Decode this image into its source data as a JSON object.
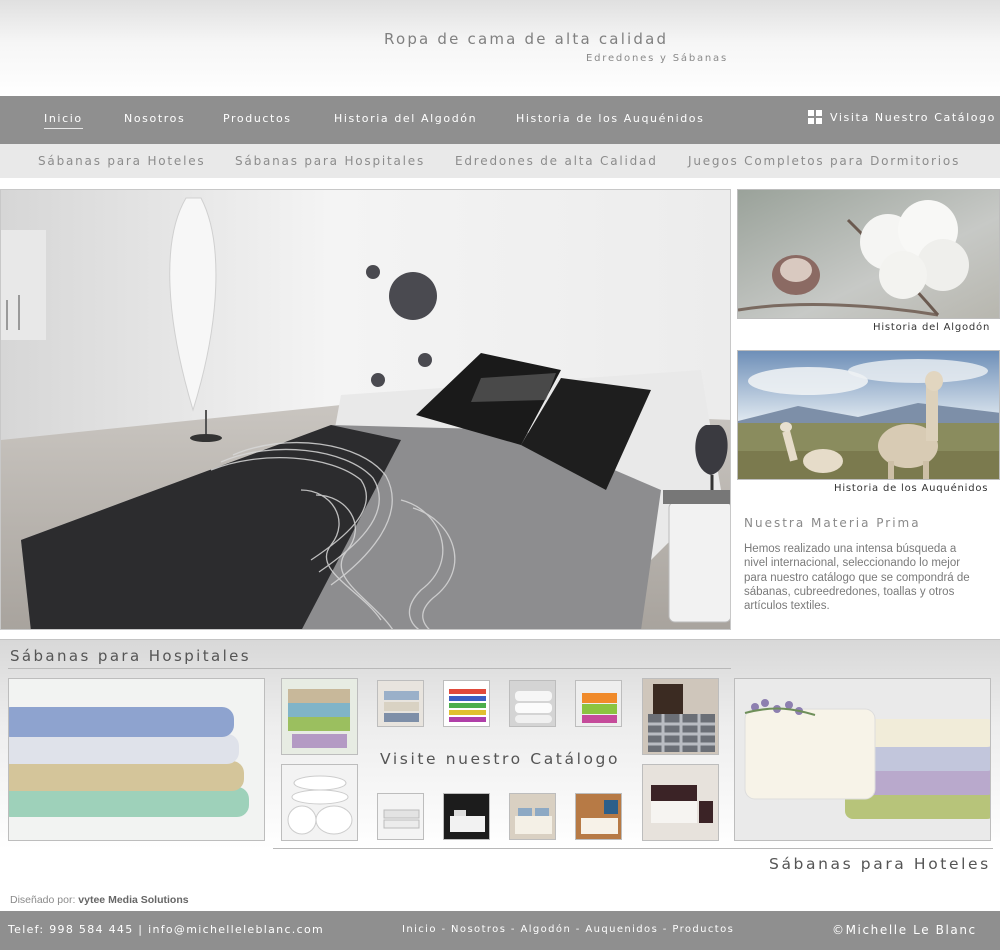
{
  "header": {
    "title": "Ropa de cama de alta calidad",
    "subtitle": "Edredones y Sábanas"
  },
  "main_nav": {
    "items": [
      {
        "label": "Inicio",
        "active": true
      },
      {
        "label": "Nosotros"
      },
      {
        "label": "Productos"
      },
      {
        "label": "Historia del Algodón"
      },
      {
        "label": "Historia de los Auquénidos"
      }
    ],
    "catalog_link": {
      "label": "Visita Nuestro Catálogo",
      "icon": "grid-icon"
    }
  },
  "sub_nav": {
    "items": [
      "Sábanas para Hoteles",
      "Sábanas para Hospitales",
      "Edredones de alta Calidad",
      "Juegos Completos para Dormitorios"
    ]
  },
  "sidebar": {
    "cotton_caption": "Historia del Algodón",
    "llama_caption": "Historia de los Auquénidos",
    "materia_title": "Nuestra Materia Prima",
    "materia_text": "Hemos realizado una intensa búsqueda a nivel internacional, seleccionando lo mejor para nuestro catálogo que se compondrá de sábanas, cubreedredones, toallas y otros artículos textiles."
  },
  "products": {
    "hospital_title": "Sábanas para Hospitales",
    "catalog_caption": "Visite nuestro Catálogo",
    "hotel_title": "Sábanas para Hoteles"
  },
  "credit": {
    "label": "Diseñado por:",
    "company": "vytee Media Solutions"
  },
  "footer": {
    "contact": "Telef: 998 584 445 | info@michelleleblanc.com",
    "links": [
      "Inicio",
      "Nosotros",
      "Algodón",
      "Auquenidos",
      "Productos"
    ],
    "separator": " - ",
    "copyright": "©Michelle Le Blanc"
  },
  "colors": {
    "nav_bg": "#8f8f8f",
    "subnav_bg": "#e9e9e9",
    "text_gray": "#808080"
  }
}
